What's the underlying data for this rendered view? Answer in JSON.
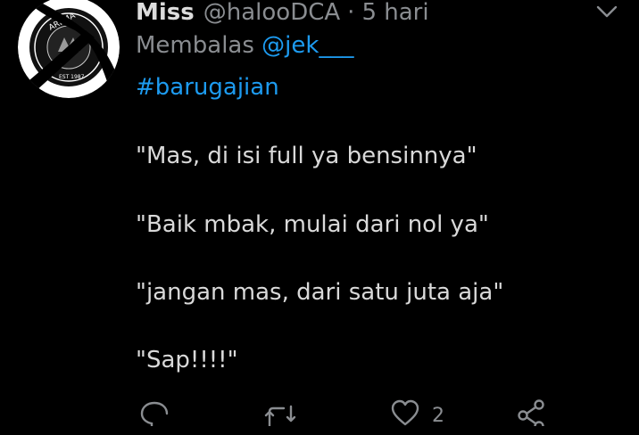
{
  "tweet": {
    "display_name": "Miss",
    "handle": "@halooDCA",
    "separator": "·",
    "time": "5 hari",
    "reply_prefix": "Membalas",
    "reply_mention": "@jek___",
    "hashtag": "#barugajian",
    "lines": [
      "\"Mas, di isi full ya bensinnya\"",
      "\"Baik mbak, mulai dari nol ya\"",
      "\"jangan mas, dari satu juta aja\"",
      "\"Sap!!!!\""
    ],
    "like_count": "2"
  },
  "avatar": {
    "badge_text": "AREMA",
    "badge_year": "EST 1987"
  },
  "colors": {
    "background": "#000000",
    "link": "#1d9bf0",
    "muted": "#8a8d91",
    "text": "#d9d9d9"
  },
  "icons": {
    "menu": "chevron-down-icon",
    "reply": "reply-icon",
    "retweet": "retweet-icon",
    "like": "heart-icon",
    "share": "share-icon"
  }
}
